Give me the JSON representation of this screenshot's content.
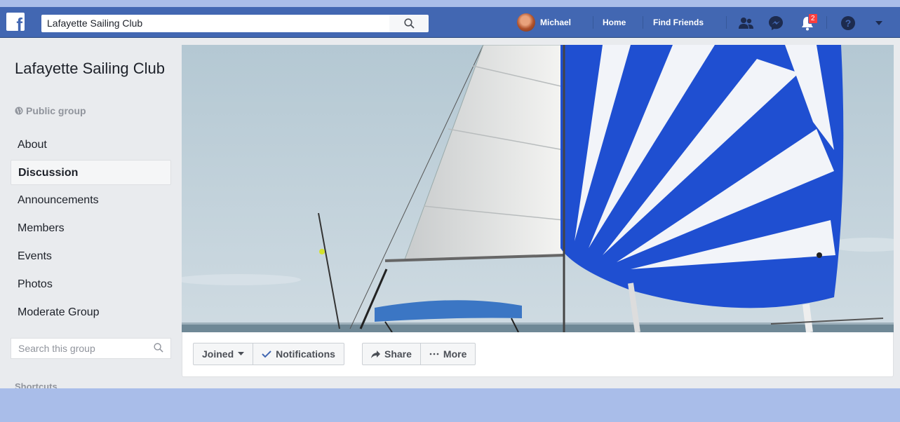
{
  "topbar": {
    "search_value": "Lafayette Sailing Club",
    "user_name": "Michael",
    "home_label": "Home",
    "find_friends_label": "Find Friends",
    "notification_count": "2"
  },
  "sidebar": {
    "group_name": "Lafayette Sailing Club",
    "privacy": "Public group",
    "items": [
      {
        "label": "About"
      },
      {
        "label": "Discussion",
        "active": true
      },
      {
        "label": "Announcements"
      },
      {
        "label": "Members"
      },
      {
        "label": "Events"
      },
      {
        "label": "Photos"
      },
      {
        "label": "Moderate Group"
      }
    ],
    "search_placeholder": "Search this group",
    "shortcuts_label": "Shortcuts"
  },
  "actions": {
    "joined_label": "Joined",
    "notifications_label": "Notifications",
    "share_label": "Share",
    "more_label": "More"
  },
  "colors": {
    "brand": "#4267b2",
    "page_bg": "#e9ebee",
    "outer_bg": "#a9bde9",
    "sail_blue": "#1f4fd1",
    "notification_red": "#fa3e3e"
  },
  "icons": [
    "facebook-logo",
    "search-icon",
    "friends-icon",
    "messenger-icon",
    "bell-icon",
    "help-icon",
    "caret-down-icon",
    "globe-icon",
    "check-icon",
    "share-arrow-icon",
    "more-dots-icon"
  ]
}
